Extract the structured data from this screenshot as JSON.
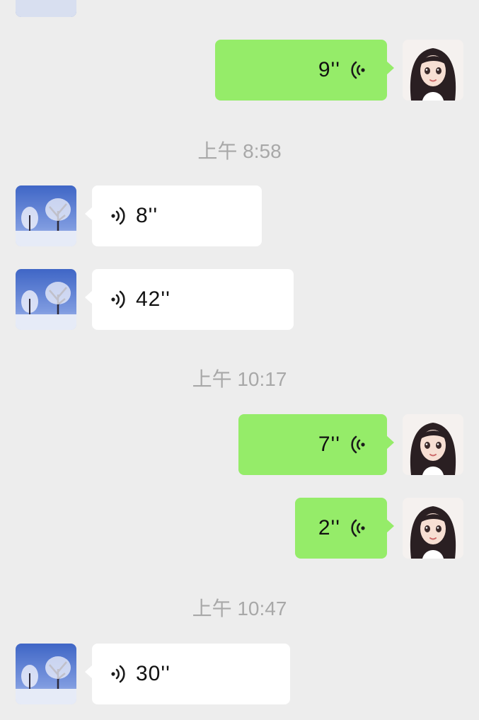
{
  "messages": [
    {
      "type": "sent",
      "duration": "9''"
    },
    {
      "type": "timestamp",
      "text": "上午 8:58"
    },
    {
      "type": "received",
      "duration": "8''"
    },
    {
      "type": "received",
      "duration": "42''"
    },
    {
      "type": "timestamp",
      "text": "上午 10:17"
    },
    {
      "type": "sent",
      "duration": "7''"
    },
    {
      "type": "sent",
      "duration": "2''"
    },
    {
      "type": "timestamp",
      "text": "上午 10:47"
    },
    {
      "type": "received",
      "duration": "30''"
    }
  ],
  "colors": {
    "background": "#ededed",
    "sent_bubble": "#95ec69",
    "received_bubble": "#ffffff",
    "timestamp_text": "#a8a8a8"
  },
  "icons": {
    "sent_avatar": "anime-girl-avatar",
    "received_avatar": "snowy-tree-avatar",
    "voice": "voice-wave-icon"
  }
}
